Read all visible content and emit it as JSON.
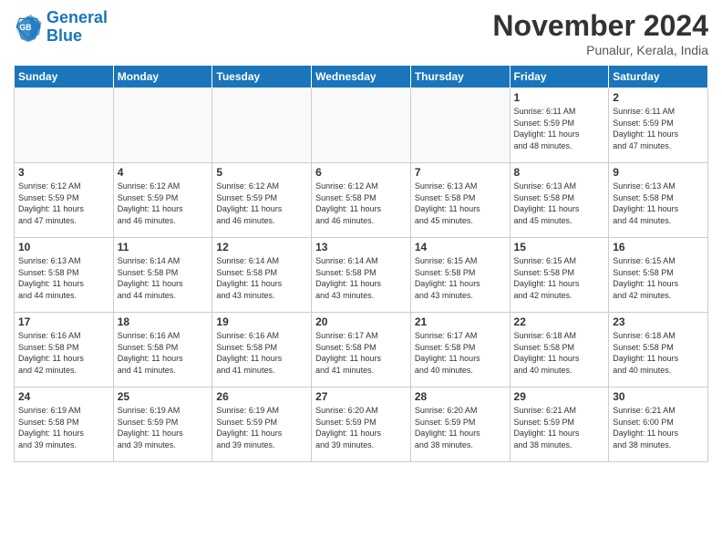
{
  "logo": {
    "line1": "General",
    "line2": "Blue"
  },
  "header": {
    "month": "November 2024",
    "location": "Punalur, Kerala, India"
  },
  "weekdays": [
    "Sunday",
    "Monday",
    "Tuesday",
    "Wednesday",
    "Thursday",
    "Friday",
    "Saturday"
  ],
  "weeks": [
    [
      {
        "day": "",
        "info": ""
      },
      {
        "day": "",
        "info": ""
      },
      {
        "day": "",
        "info": ""
      },
      {
        "day": "",
        "info": ""
      },
      {
        "day": "",
        "info": ""
      },
      {
        "day": "1",
        "info": "Sunrise: 6:11 AM\nSunset: 5:59 PM\nDaylight: 11 hours\nand 48 minutes."
      },
      {
        "day": "2",
        "info": "Sunrise: 6:11 AM\nSunset: 5:59 PM\nDaylight: 11 hours\nand 47 minutes."
      }
    ],
    [
      {
        "day": "3",
        "info": "Sunrise: 6:12 AM\nSunset: 5:59 PM\nDaylight: 11 hours\nand 47 minutes."
      },
      {
        "day": "4",
        "info": "Sunrise: 6:12 AM\nSunset: 5:59 PM\nDaylight: 11 hours\nand 46 minutes."
      },
      {
        "day": "5",
        "info": "Sunrise: 6:12 AM\nSunset: 5:59 PM\nDaylight: 11 hours\nand 46 minutes."
      },
      {
        "day": "6",
        "info": "Sunrise: 6:12 AM\nSunset: 5:58 PM\nDaylight: 11 hours\nand 46 minutes."
      },
      {
        "day": "7",
        "info": "Sunrise: 6:13 AM\nSunset: 5:58 PM\nDaylight: 11 hours\nand 45 minutes."
      },
      {
        "day": "8",
        "info": "Sunrise: 6:13 AM\nSunset: 5:58 PM\nDaylight: 11 hours\nand 45 minutes."
      },
      {
        "day": "9",
        "info": "Sunrise: 6:13 AM\nSunset: 5:58 PM\nDaylight: 11 hours\nand 44 minutes."
      }
    ],
    [
      {
        "day": "10",
        "info": "Sunrise: 6:13 AM\nSunset: 5:58 PM\nDaylight: 11 hours\nand 44 minutes."
      },
      {
        "day": "11",
        "info": "Sunrise: 6:14 AM\nSunset: 5:58 PM\nDaylight: 11 hours\nand 44 minutes."
      },
      {
        "day": "12",
        "info": "Sunrise: 6:14 AM\nSunset: 5:58 PM\nDaylight: 11 hours\nand 43 minutes."
      },
      {
        "day": "13",
        "info": "Sunrise: 6:14 AM\nSunset: 5:58 PM\nDaylight: 11 hours\nand 43 minutes."
      },
      {
        "day": "14",
        "info": "Sunrise: 6:15 AM\nSunset: 5:58 PM\nDaylight: 11 hours\nand 43 minutes."
      },
      {
        "day": "15",
        "info": "Sunrise: 6:15 AM\nSunset: 5:58 PM\nDaylight: 11 hours\nand 42 minutes."
      },
      {
        "day": "16",
        "info": "Sunrise: 6:15 AM\nSunset: 5:58 PM\nDaylight: 11 hours\nand 42 minutes."
      }
    ],
    [
      {
        "day": "17",
        "info": "Sunrise: 6:16 AM\nSunset: 5:58 PM\nDaylight: 11 hours\nand 42 minutes."
      },
      {
        "day": "18",
        "info": "Sunrise: 6:16 AM\nSunset: 5:58 PM\nDaylight: 11 hours\nand 41 minutes."
      },
      {
        "day": "19",
        "info": "Sunrise: 6:16 AM\nSunset: 5:58 PM\nDaylight: 11 hours\nand 41 minutes."
      },
      {
        "day": "20",
        "info": "Sunrise: 6:17 AM\nSunset: 5:58 PM\nDaylight: 11 hours\nand 41 minutes."
      },
      {
        "day": "21",
        "info": "Sunrise: 6:17 AM\nSunset: 5:58 PM\nDaylight: 11 hours\nand 40 minutes."
      },
      {
        "day": "22",
        "info": "Sunrise: 6:18 AM\nSunset: 5:58 PM\nDaylight: 11 hours\nand 40 minutes."
      },
      {
        "day": "23",
        "info": "Sunrise: 6:18 AM\nSunset: 5:58 PM\nDaylight: 11 hours\nand 40 minutes."
      }
    ],
    [
      {
        "day": "24",
        "info": "Sunrise: 6:19 AM\nSunset: 5:58 PM\nDaylight: 11 hours\nand 39 minutes."
      },
      {
        "day": "25",
        "info": "Sunrise: 6:19 AM\nSunset: 5:59 PM\nDaylight: 11 hours\nand 39 minutes."
      },
      {
        "day": "26",
        "info": "Sunrise: 6:19 AM\nSunset: 5:59 PM\nDaylight: 11 hours\nand 39 minutes."
      },
      {
        "day": "27",
        "info": "Sunrise: 6:20 AM\nSunset: 5:59 PM\nDaylight: 11 hours\nand 39 minutes."
      },
      {
        "day": "28",
        "info": "Sunrise: 6:20 AM\nSunset: 5:59 PM\nDaylight: 11 hours\nand 38 minutes."
      },
      {
        "day": "29",
        "info": "Sunrise: 6:21 AM\nSunset: 5:59 PM\nDaylight: 11 hours\nand 38 minutes."
      },
      {
        "day": "30",
        "info": "Sunrise: 6:21 AM\nSunset: 6:00 PM\nDaylight: 11 hours\nand 38 minutes."
      }
    ]
  ]
}
